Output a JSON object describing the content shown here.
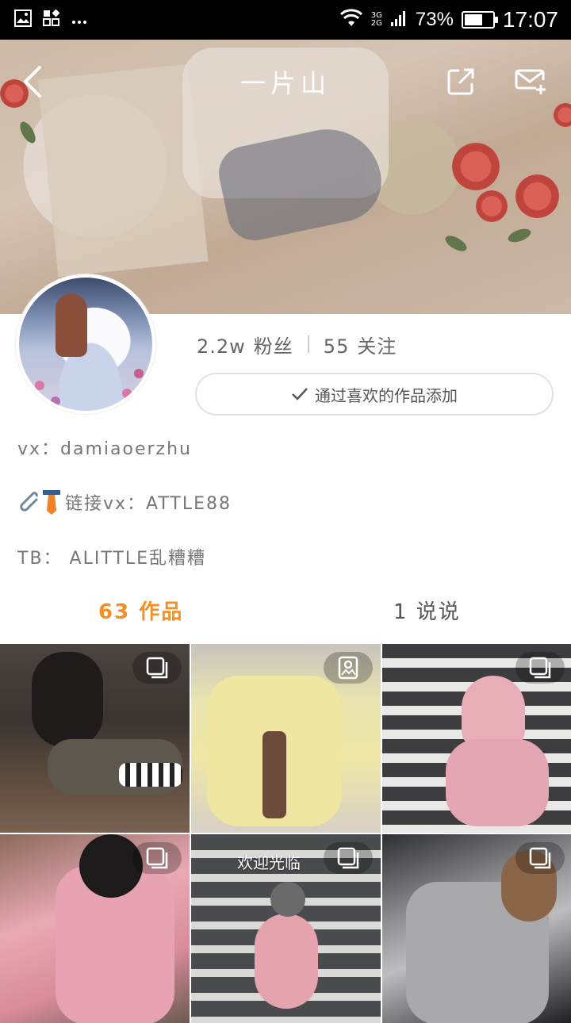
{
  "status_bar": {
    "network": "3G\n2G",
    "battery_percent": "73%",
    "battery_level": 0.73,
    "time": "17:07"
  },
  "header": {
    "title": "一片山"
  },
  "profile": {
    "fans_count": "2.2w",
    "fans_label": "粉丝",
    "following_count": "55",
    "following_label": "关注",
    "add_button_label": "通过喜欢的作品添加",
    "bio_line1": "vx：damiaoerzhu",
    "bio_line2": "链接vx：ATTLE88",
    "bio_line3": "TB： ALITTLE乱糟糟"
  },
  "tabs": {
    "works": "63 作品",
    "posts": "1 说说"
  },
  "grid": {
    "overlay_text": "欢迎光临"
  },
  "colors": {
    "accent": "#f29026",
    "status_bar_bg": "#000000"
  }
}
